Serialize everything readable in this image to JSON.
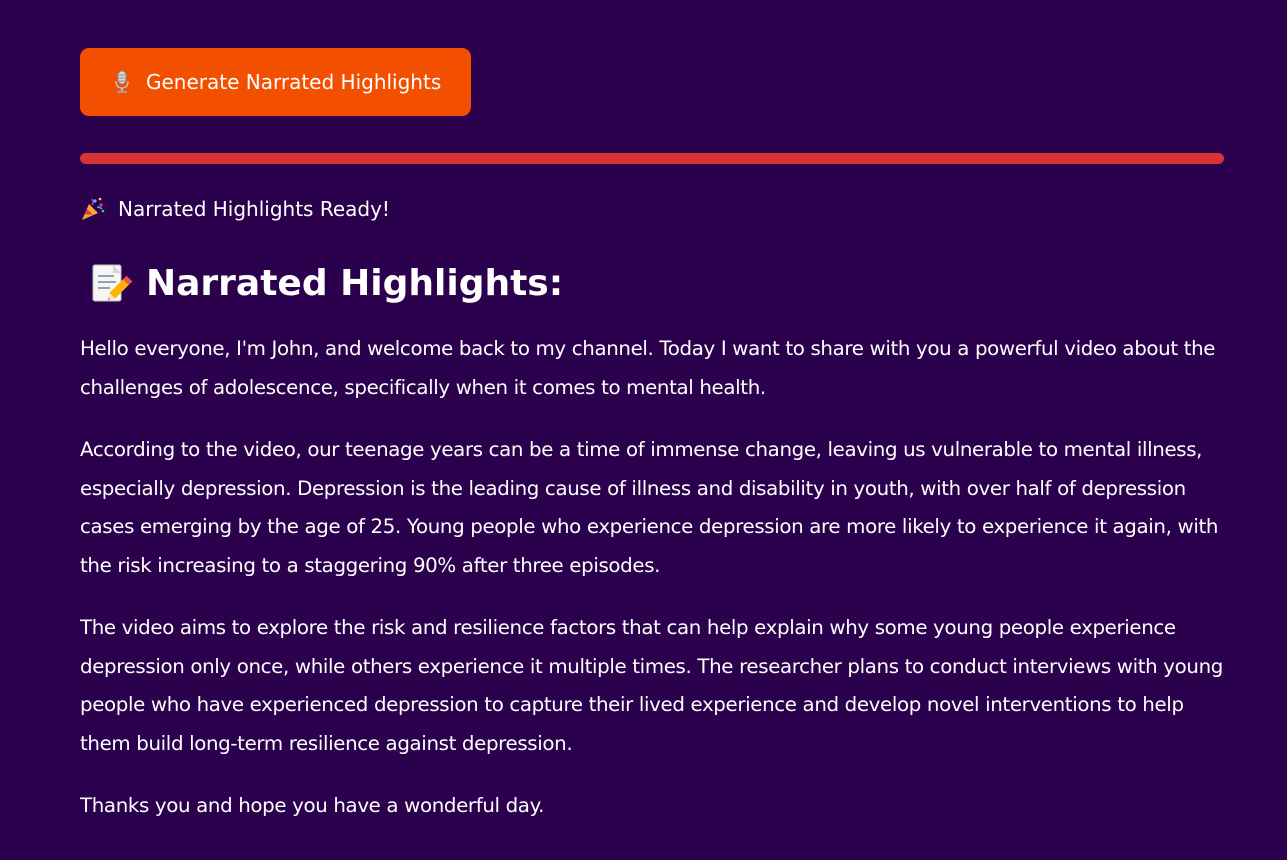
{
  "generate_button": {
    "label": "Generate Narrated Highlights",
    "icon": "microphone-icon"
  },
  "progress": {
    "value": 1.0,
    "color": "#d83333"
  },
  "status": {
    "icon": "party-popper-icon",
    "text": "Narrated Highlights Ready!"
  },
  "section": {
    "icon": "memo-pencil-icon",
    "title": "Narrated Highlights:"
  },
  "paragraphs": [
    "Hello everyone, I'm John, and welcome back to my channel. Today I want to share with you a powerful video about the challenges of adolescence, specifically when it comes to mental health.",
    "According to the video, our teenage years can be a time of immense change, leaving us vulnerable to mental illness, especially depression. Depression is the leading cause of illness and disability in youth, with over half of depression cases emerging by the age of 25. Young people who experience depression are more likely to experience it again, with the risk increasing to a staggering 90% after three episodes.",
    "The video aims to explore the risk and resilience factors that can help explain why some young people experience depression only once, while others experience it multiple times. The researcher plans to conduct interviews with young people who have experienced depression to capture their lived experience and develop novel interventions to help them build long-term resilience against depression.",
    "Thanks you and hope you have a wonderful day."
  ],
  "colors": {
    "background": "#2b004c",
    "button": "#f24f00",
    "text": "#ffffff"
  }
}
